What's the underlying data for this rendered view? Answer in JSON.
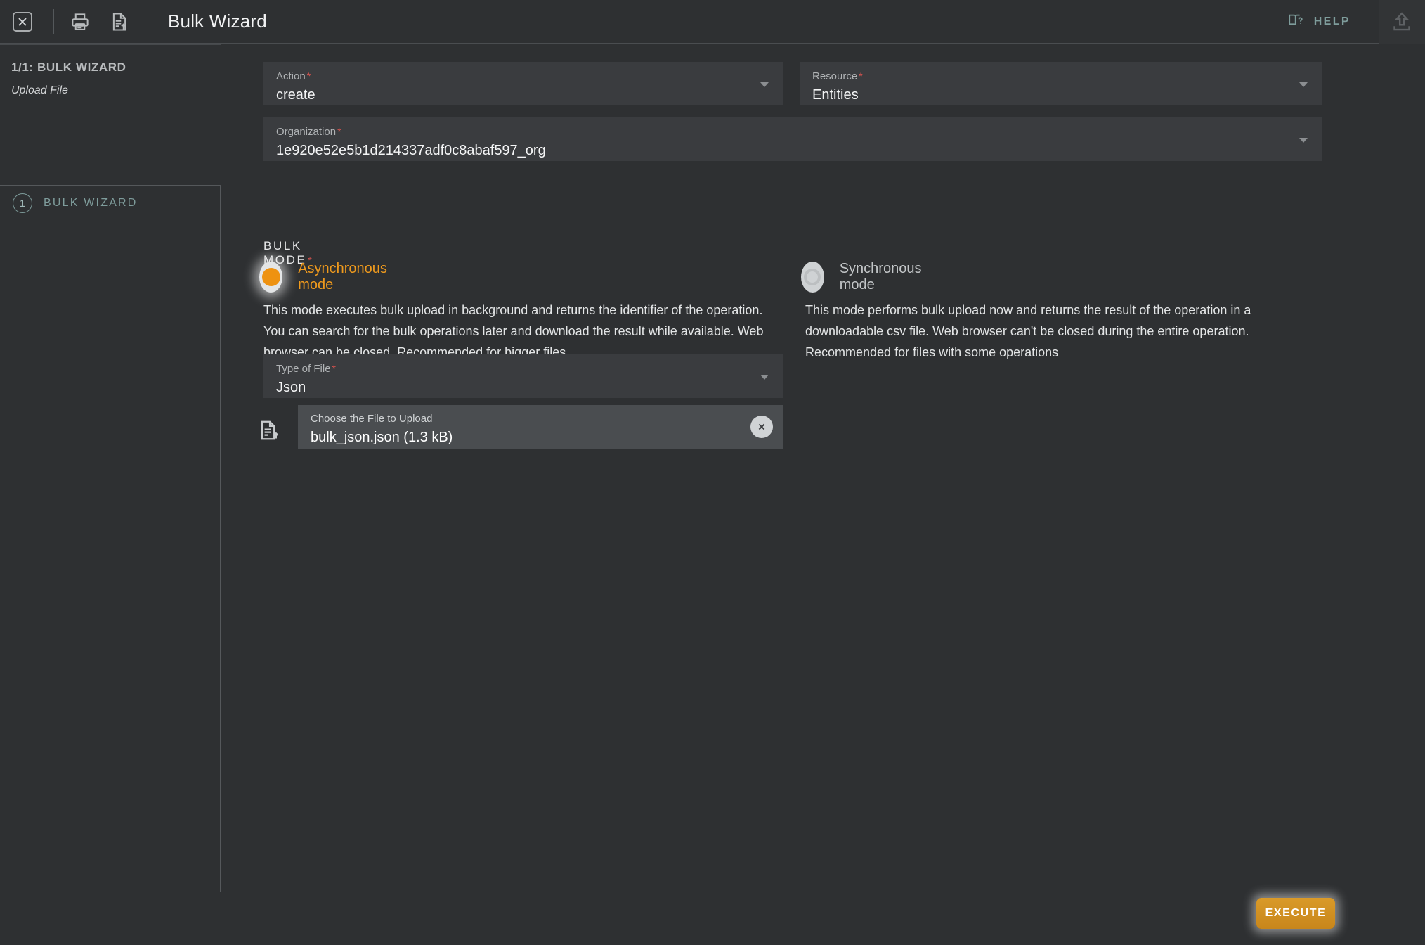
{
  "header": {
    "title": "Bulk Wizard",
    "close_icon": "close-box-icon",
    "print_icon": "printer-icon",
    "export_icon": "document-upload-icon",
    "help_label": "HELP",
    "help_icon": "book-question-icon",
    "upload_icon": "upload-arrow-icon"
  },
  "sidebar": {
    "step_counter": "1/1: BULK WIZARD",
    "subtitle": "Upload File",
    "nav": [
      {
        "number": "1",
        "label": "BULK WIZARD"
      }
    ]
  },
  "form": {
    "fields": [
      {
        "label": "Action",
        "required": "*",
        "value": "create"
      },
      {
        "label": "Resource",
        "required": "*",
        "value": "Entities"
      },
      {
        "label": "Organization",
        "required": "*",
        "value": "1e920e52e5b1d214337adf0c8abaf597_org"
      },
      {
        "label": "Type of File",
        "required": "*",
        "value": "Json"
      },
      {
        "label": "Choose the File to Upload",
        "value": "bulk_json.json (1.3 kB)"
      }
    ],
    "bulk_mode": {
      "section_label": "BULK MODE",
      "required": "*",
      "options": [
        {
          "label": "Asynchronous mode",
          "selected": true,
          "description": "This mode executes bulk upload in background and returns the identifier of the operation. You can search for the bulk operations later and download the result while available. Web browser can be closed. Recommended for bigger files"
        },
        {
          "label": "Synchronous mode",
          "selected": false,
          "description": "This mode performs bulk upload now and returns the result of the operation in a downloadable csv file. Web browser can't be closed during the entire operation. Recommended for files with some operations"
        }
      ]
    }
  },
  "footer": {
    "execute_label": "EXECUTE"
  },
  "colors": {
    "accent_orange": "#ee9211",
    "teal": "#7e9c9b",
    "required_red": "#d9534f",
    "background": "#2e3032",
    "field_background": "#3a3c3f"
  }
}
